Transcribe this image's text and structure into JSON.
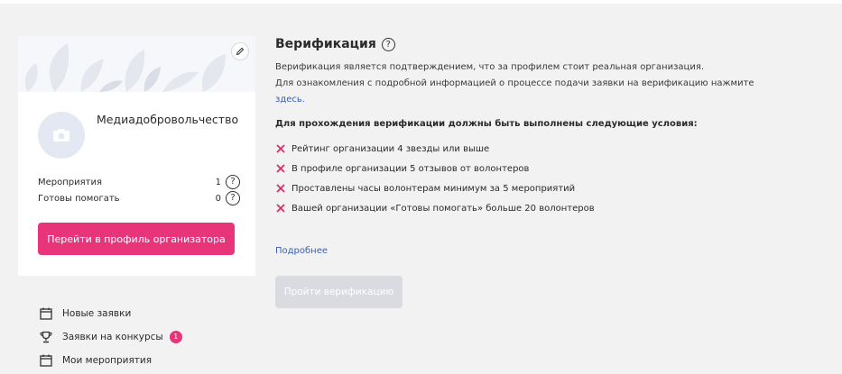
{
  "profile": {
    "org_name": "Медиадобровольчество",
    "stats": [
      {
        "label": "Мероприятия",
        "value": "1",
        "help": "?"
      },
      {
        "label": "Готовы помогать",
        "value": "0",
        "help": "?"
      }
    ],
    "profile_button": "Перейти в профиль организатора"
  },
  "nav": {
    "items": [
      {
        "label": "Новые заявки",
        "icon": "calendar-icon"
      },
      {
        "label": "Заявки на конкурсы",
        "icon": "trophy-icon",
        "badge": "1"
      },
      {
        "label": "Мои мероприятия",
        "icon": "calendar-icon"
      }
    ]
  },
  "verification": {
    "title": "Верификация",
    "help": "?",
    "description_1": "Верификация является подтверждением, что за профилем стоит реальная организация.",
    "description_2": "Для ознакомления с подробной информацией о процессе подачи заявки на верификацию нажмите",
    "here_link": "здесь.",
    "conditions_title": "Для прохождения верификации должны быть выполнены следующие условия:",
    "conditions": [
      "Рейтинг организации 4 звезды или выше",
      "В профиле организации 5 отзывов от волонтеров",
      "Проставлены часы волонтерам минимум за 5 мероприятий",
      "Вашей организации «Готовы помогать» больше 20 волонтеров"
    ],
    "more_link": "Подробнее",
    "verify_button": "Пройти верификацию"
  },
  "colors": {
    "accent": "#e8357a",
    "link": "#3a5fb0",
    "cross": "#d6306b",
    "disabled_button": "#d9dbe0"
  }
}
